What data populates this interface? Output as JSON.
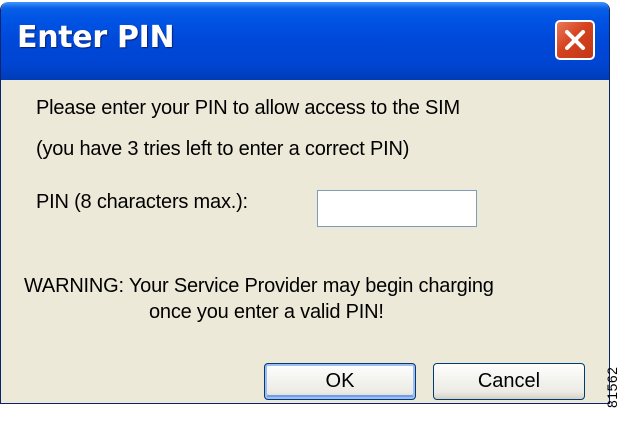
{
  "dialog": {
    "title": "Enter PIN",
    "close_icon": "close-icon",
    "message_line1": "Please enter your PIN to allow access to the SIM",
    "message_line2": "(you have 3 tries left to enter a correct PIN)",
    "pin_label": "PIN (8 characters max.):",
    "pin_value": "",
    "warning_line1": "WARNING: Your Service Provider may begin charging",
    "warning_line2": "once you enter a valid PIN!",
    "ok_label": "OK",
    "cancel_label": "Cancel"
  },
  "figure_code": "81562",
  "colors": {
    "titlebar": "#0055e5",
    "dialog_bg": "#ece9d8",
    "close_button": "#d5431f"
  }
}
